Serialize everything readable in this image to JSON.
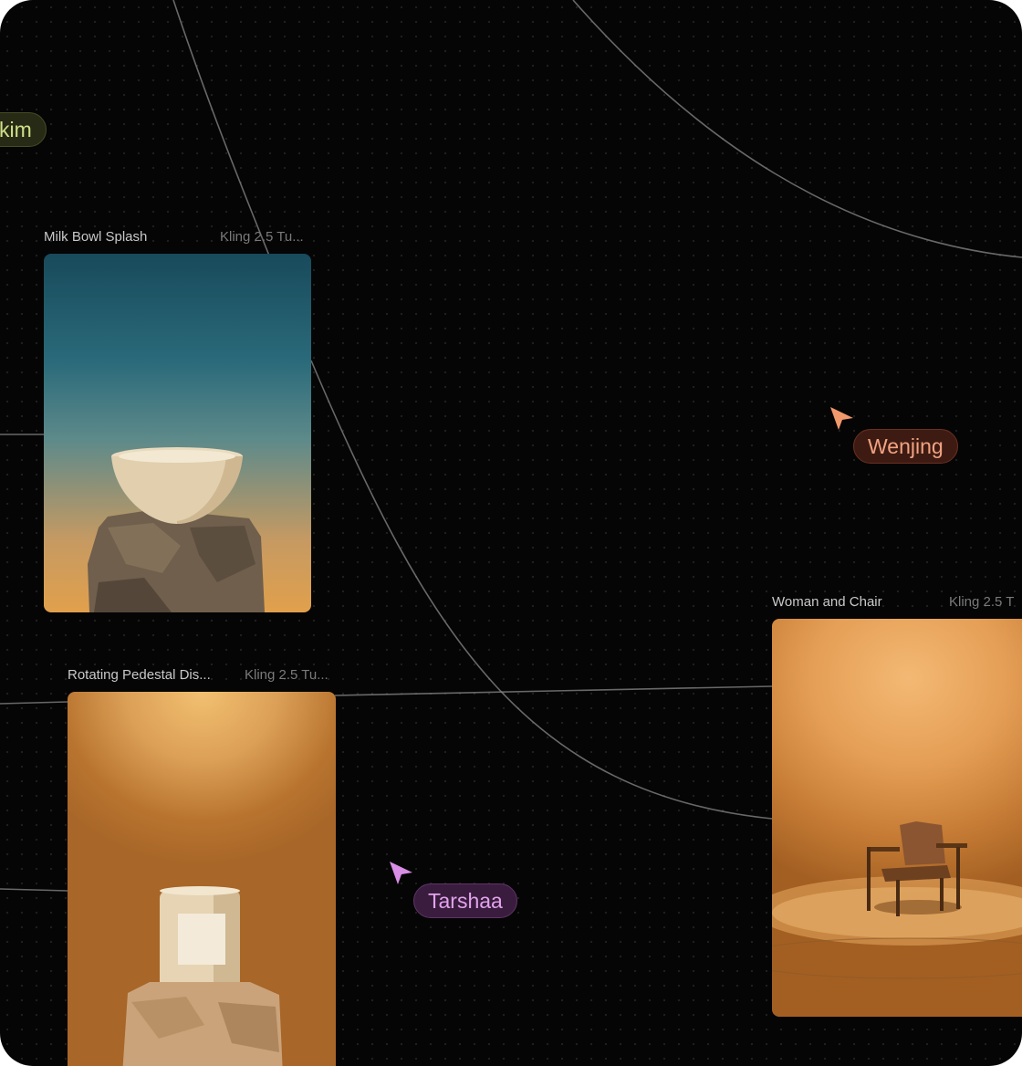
{
  "canvas": {
    "background": "#050505",
    "edge_color": "#8a8a8a"
  },
  "nodes": [
    {
      "id": "milk",
      "title": "Milk Bowl Splash",
      "model": "Kling 2.5 Tu...",
      "image": "bowl on rock pedestal, teal to orange gradient"
    },
    {
      "id": "pedestal",
      "title": "Rotating Pedestal Dis...",
      "model": "Kling 2.5 Tu...",
      "image": "candle jar on stone pedestal, amber light"
    },
    {
      "id": "chair",
      "title": "Woman and Chair",
      "model": "Kling 2.5 T",
      "image": "wooden armchair in spotlight, orange studio"
    }
  ],
  "cursors": [
    {
      "name": "Wenjing",
      "color": "#f1a382",
      "icon": "pointer-arrow-icon"
    },
    {
      "name": "Tarshaa",
      "color": "#e2a3ec",
      "icon": "pointer-arrow-icon"
    },
    {
      "name": "kim",
      "color": "#cfe089"
    }
  ]
}
